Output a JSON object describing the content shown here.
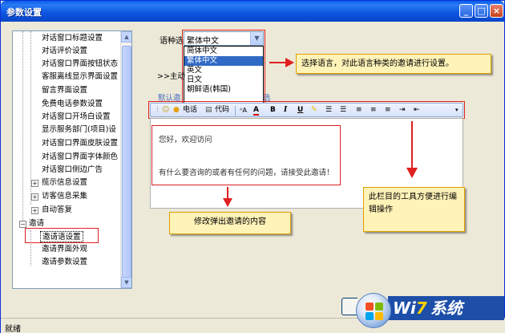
{
  "window": {
    "title": "参数设置"
  },
  "titlebar_buttons": {
    "minimize": "_",
    "maximize": "□",
    "close": "×"
  },
  "sidebar": {
    "items": [
      {
        "label": "对话窗口标题设置"
      },
      {
        "label": "对话评价设置"
      },
      {
        "label": "对话窗口界面按钮状态"
      },
      {
        "label": "客服离线显示界面设置"
      },
      {
        "label": "留言界面设置"
      },
      {
        "label": "免费电话参数设置"
      },
      {
        "label": "对话窗口开场白设置"
      },
      {
        "label": "显示服务部门(项目)设"
      },
      {
        "label": "对话窗口界面皮肤设置"
      },
      {
        "label": "对话窗口界面字体颜色"
      },
      {
        "label": "对话窗口侧边广告"
      },
      {
        "label": "揽示信息设置"
      },
      {
        "label": "访客信息采集"
      },
      {
        "label": "自动答复"
      },
      {
        "label": "邀请"
      },
      {
        "label": "邀请语设置"
      },
      {
        "label": "邀请界面外观"
      },
      {
        "label": "邀请参数设置"
      }
    ]
  },
  "language": {
    "label": "语种选择：",
    "selected": "繁体中文",
    "options": [
      "简体中文",
      "繁体中文",
      "英文",
      "日文",
      "朝鲜语(韩国)"
    ],
    "highlighted_index": 1
  },
  "breadcrumb": ">>主动",
  "tabs": {
    "default": "默认邀",
    "other": "选"
  },
  "toolbar": {
    "phone": "电话",
    "code": "代码",
    "bold": "B",
    "italic": "I",
    "underline": "U"
  },
  "editor": {
    "line1": "您好，欢迎访问",
    "line2": "有什么要咨询的或者有任何的问题，请接受此邀请！"
  },
  "callouts": {
    "language": "选择语言，对此语言种类的邀请进行设置。",
    "content": "修改弹出邀请的内容",
    "toolbar": "此栏目的工具方便进行编辑操作"
  },
  "statusbar": {
    "text": "就绪"
  },
  "logo": {
    "text_prefix": "Wi",
    "text_seven": "7",
    "text_suffix": "系统"
  },
  "colors": {
    "accent_red": "#e02020",
    "callout_bg": "#fff3b8",
    "title_blue": "#0a5de8"
  }
}
